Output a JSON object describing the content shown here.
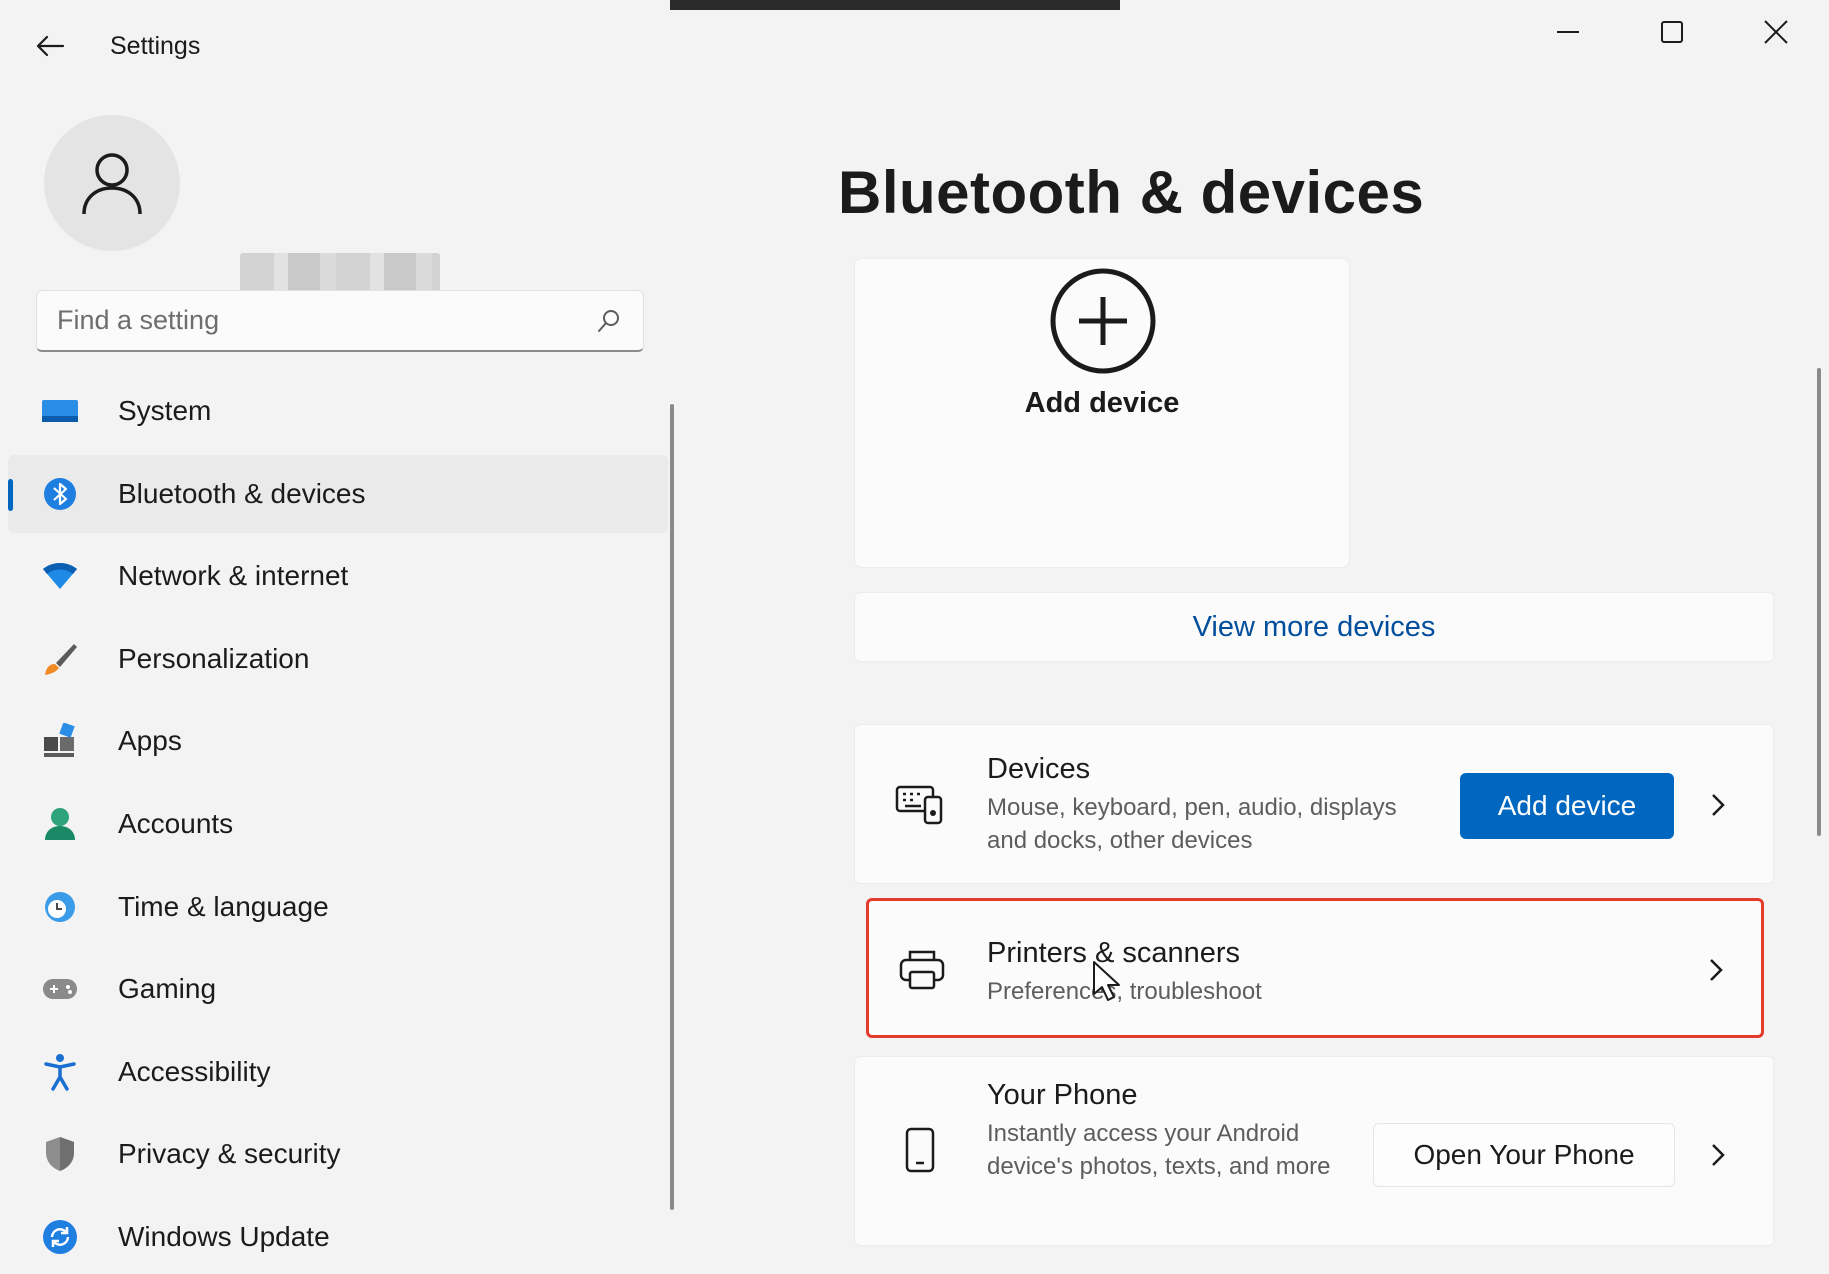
{
  "window": {
    "title": "Settings",
    "controls": [
      "minimize-icon",
      "maximize-icon",
      "close-icon"
    ]
  },
  "search": {
    "placeholder": "Find a setting"
  },
  "sidebar": {
    "items": [
      {
        "label": "System",
        "icon": "system-icon",
        "selected": false
      },
      {
        "label": "Bluetooth & devices",
        "icon": "bluetooth-icon",
        "selected": true
      },
      {
        "label": "Network & internet",
        "icon": "wifi-icon",
        "selected": false
      },
      {
        "label": "Personalization",
        "icon": "brush-icon",
        "selected": false
      },
      {
        "label": "Apps",
        "icon": "apps-icon",
        "selected": false
      },
      {
        "label": "Accounts",
        "icon": "accounts-icon",
        "selected": false
      },
      {
        "label": "Time & language",
        "icon": "clock-globe-icon",
        "selected": false
      },
      {
        "label": "Gaming",
        "icon": "gamepad-icon",
        "selected": false
      },
      {
        "label": "Accessibility",
        "icon": "accessibility-icon",
        "selected": false
      },
      {
        "label": "Privacy & security",
        "icon": "shield-icon",
        "selected": false
      },
      {
        "label": "Windows Update",
        "icon": "update-icon",
        "selected": false
      }
    ]
  },
  "main": {
    "title": "Bluetooth & devices",
    "add_tile_label": "Add device",
    "view_more": "View more devices",
    "devices": {
      "title": "Devices",
      "desc": "Mouse, keyboard, pen, audio, displays and docks, other devices",
      "button": "Add device"
    },
    "printers": {
      "title": "Printers & scanners",
      "desc": "Preferences, troubleshoot"
    },
    "phone": {
      "title": "Your Phone",
      "desc": "Instantly access your Android device's photos, texts, and more",
      "button": "Open Your Phone"
    }
  },
  "colors": {
    "accent": "#0067c0",
    "highlight": "#e53b2c",
    "link": "#004e9c"
  }
}
